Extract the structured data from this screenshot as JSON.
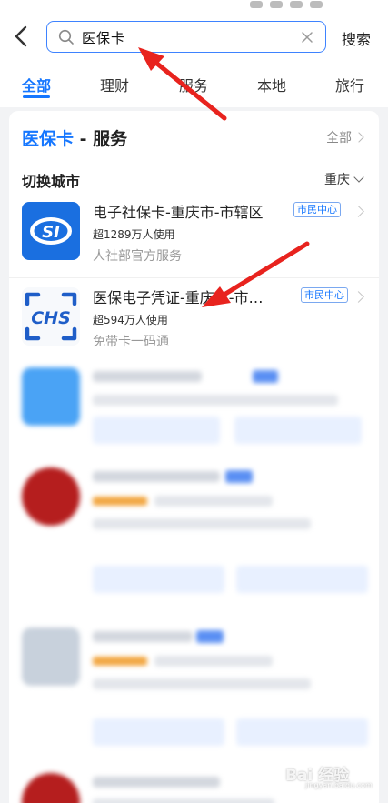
{
  "search": {
    "query": "医保卡",
    "submit_label": "搜索"
  },
  "tabs": [
    {
      "label": "全部",
      "active": true
    },
    {
      "label": "理财"
    },
    {
      "label": "服务"
    },
    {
      "label": "本地"
    },
    {
      "label": "旅行"
    }
  ],
  "section": {
    "keyword": "医保卡",
    "title_suffix": " - 服务",
    "all_label": "全部"
  },
  "city": {
    "label": "切换城市",
    "selected": "重庆"
  },
  "results": [
    {
      "name": "电子社保卡-重庆市-市辖区",
      "tag": "市民中心",
      "users": "超1289万人使用",
      "desc": "人社部官方服务",
      "logo_text": "SI",
      "icon": "social-security-logo"
    },
    {
      "name": "医保电子凭证-重庆市-市…",
      "tag": "市民中心",
      "users": "超594万人使用",
      "desc": "免带卡一码通",
      "logo_text": "CHS",
      "icon": "chs-medical-insurance-logo"
    }
  ],
  "watermark": {
    "text": "Bai 经验",
    "sub": "jingyan.baidu.com"
  },
  "colors": {
    "accent": "#1677ff",
    "annotation_arrow": "#e8231e",
    "si_logo_bg": "#1a6fe0",
    "chs_logo": "#1f5ec8"
  }
}
